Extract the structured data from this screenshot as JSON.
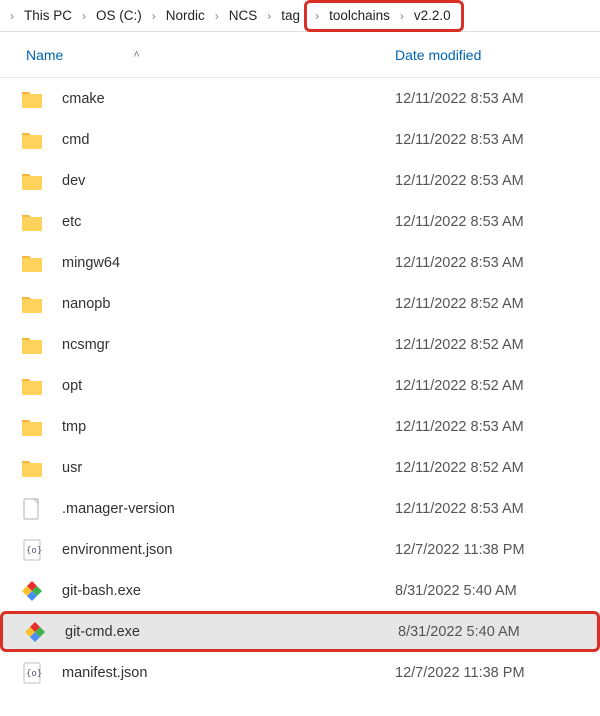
{
  "breadcrumb": {
    "items": [
      {
        "label": "This PC"
      },
      {
        "label": "OS (C:)"
      },
      {
        "label": "Nordic"
      },
      {
        "label": "NCS"
      },
      {
        "label": "tag"
      },
      {
        "label": "toolchains"
      },
      {
        "label": "v2.2.0"
      }
    ]
  },
  "columns": {
    "name": "Name",
    "date": "Date modified"
  },
  "files": [
    {
      "name": "cmake",
      "date": "12/11/2022 8:53 AM",
      "icon": "folder"
    },
    {
      "name": "cmd",
      "date": "12/11/2022 8:53 AM",
      "icon": "folder"
    },
    {
      "name": "dev",
      "date": "12/11/2022 8:53 AM",
      "icon": "folder"
    },
    {
      "name": "etc",
      "date": "12/11/2022 8:53 AM",
      "icon": "folder"
    },
    {
      "name": "mingw64",
      "date": "12/11/2022 8:53 AM",
      "icon": "folder"
    },
    {
      "name": "nanopb",
      "date": "12/11/2022 8:52 AM",
      "icon": "folder"
    },
    {
      "name": "ncsmgr",
      "date": "12/11/2022 8:52 AM",
      "icon": "folder"
    },
    {
      "name": "opt",
      "date": "12/11/2022 8:52 AM",
      "icon": "folder"
    },
    {
      "name": "tmp",
      "date": "12/11/2022 8:53 AM",
      "icon": "folder"
    },
    {
      "name": "usr",
      "date": "12/11/2022 8:52 AM",
      "icon": "folder"
    },
    {
      "name": ".manager-version",
      "date": "12/11/2022 8:53 AM",
      "icon": "page"
    },
    {
      "name": "environment.json",
      "date": "12/7/2022 11:38 PM",
      "icon": "json"
    },
    {
      "name": "git-bash.exe",
      "date": "8/31/2022 5:40 AM",
      "icon": "git"
    },
    {
      "name": "git-cmd.exe",
      "date": "8/31/2022 5:40 AM",
      "icon": "git",
      "selected": true,
      "highlight": true
    },
    {
      "name": "manifest.json",
      "date": "12/7/2022 11:38 PM",
      "icon": "json"
    }
  ]
}
